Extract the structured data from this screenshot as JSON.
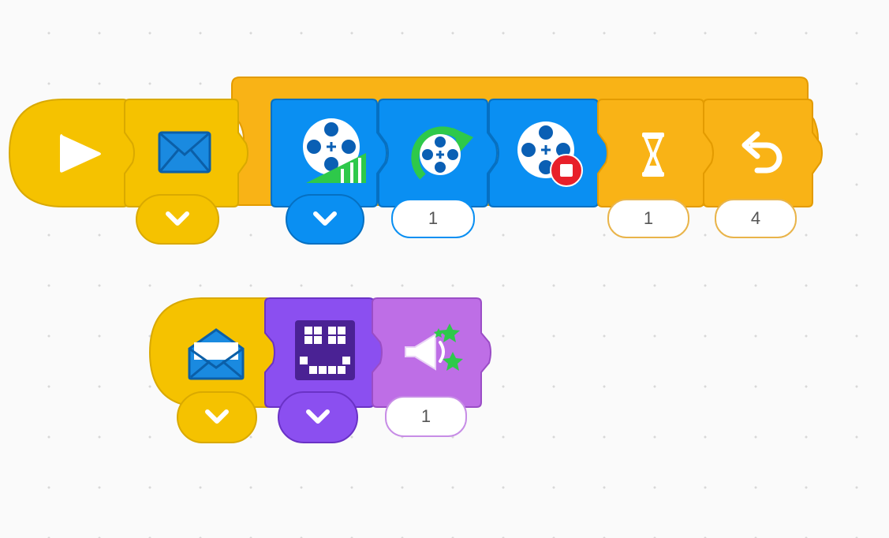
{
  "colors": {
    "events": "#f5c200",
    "events_dark": "#d9a900",
    "control": "#f9b316",
    "control_dark": "#e39b00",
    "motor": "#0a8ff2",
    "motor_dark": "#0670c2",
    "display": "#8b4ff0",
    "display_dark": "#6a32c6",
    "sound": "#be6ee6",
    "sound_dark": "#9a4dc6",
    "icon_white": "#ffffff",
    "icon_green": "#2ec94a",
    "icon_red": "#e8202a"
  },
  "stack1": {
    "blocks": [
      {
        "name": "start-on-green-flag",
        "category": "events",
        "icon": "play-icon"
      },
      {
        "name": "when-message-received",
        "category": "events",
        "icon": "envelope-icon",
        "dropdown": true
      },
      {
        "name": "repeat-loop",
        "category": "control",
        "icon": "loop-icon",
        "input": "4"
      },
      {
        "name": "motor-set-speed",
        "category": "motor",
        "icon": "motor-speed-icon",
        "dropdown": true
      },
      {
        "name": "motor-run-rotations",
        "category": "motor",
        "icon": "motor-rotate-icon",
        "input": "1"
      },
      {
        "name": "motor-stop",
        "category": "motor",
        "icon": "motor-stop-icon"
      },
      {
        "name": "wait-seconds",
        "category": "control",
        "icon": "hourglass-icon",
        "input": "1"
      }
    ],
    "inputs": {
      "rotations": "1",
      "wait": "1",
      "repeat": "4"
    }
  },
  "stack2": {
    "blocks": [
      {
        "name": "broadcast-message",
        "category": "events",
        "icon": "open-envelope-icon",
        "dropdown": true
      },
      {
        "name": "display-image",
        "category": "display",
        "icon": "face-grid-icon",
        "dropdown": true
      },
      {
        "name": "play-sound",
        "category": "sound",
        "icon": "megaphone-icon",
        "input": "1"
      }
    ],
    "inputs": {
      "sound": "1"
    }
  }
}
